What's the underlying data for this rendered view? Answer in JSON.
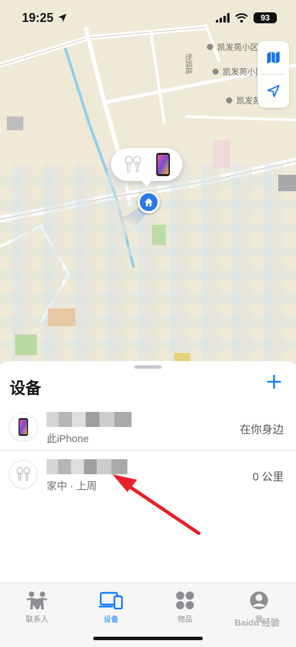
{
  "status_bar": {
    "time": "19:25",
    "battery": "93"
  },
  "map": {
    "poi_labels": [
      "凯发苑小区",
      "凯发苑小区",
      "凯发苑小区"
    ],
    "road_label": "怡园路"
  },
  "sheet": {
    "title": "设备",
    "devices": [
      {
        "subtitle": "此iPhone",
        "distance": "在你身边",
        "icon": "iphone-icon"
      },
      {
        "subtitle": "家中 · 上周",
        "distance": "0 公里",
        "icon": "airpods-icon"
      }
    ]
  },
  "tabs": [
    {
      "label": "联系人",
      "icon": "people-icon",
      "active": false
    },
    {
      "label": "设备",
      "icon": "devices-icon",
      "active": true
    },
    {
      "label": "物品",
      "icon": "items-icon",
      "active": false
    },
    {
      "label": "我",
      "icon": "profile-icon",
      "active": false
    }
  ],
  "watermark": "Baidu 经验",
  "colors": {
    "accent": "#0a7aff",
    "annotation_arrow": "#e8202a"
  }
}
